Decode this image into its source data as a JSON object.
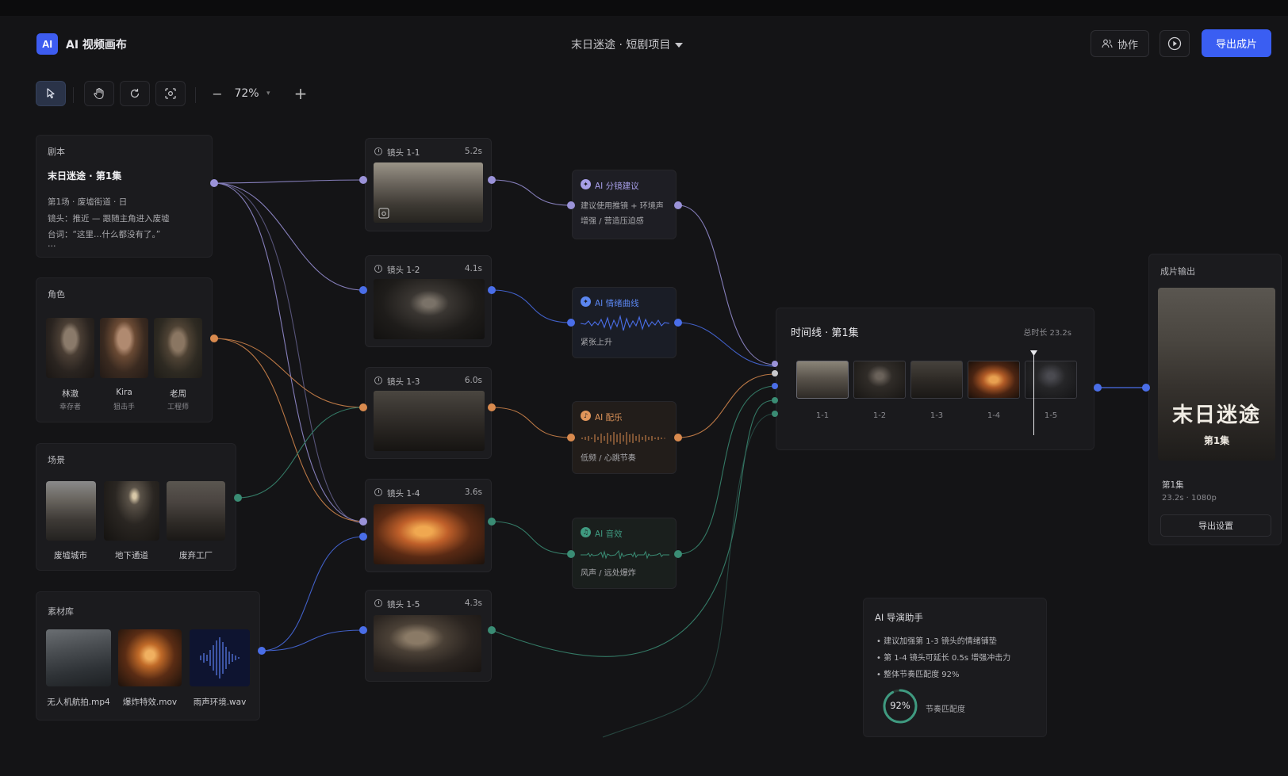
{
  "header": {
    "logo_text": "AI",
    "app_title": "AI 视频画布",
    "project_title": "末日迷途 · 短剧项目",
    "collab_label": "协作",
    "export_label": "导出成片"
  },
  "toolbar": {
    "zoom": "72%",
    "zoom_minus": "−",
    "zoom_plus": "+"
  },
  "script_panel": {
    "title": "剧本",
    "name": "末日迷途 · 第1集",
    "lines": [
      "第1场 · 废墟街道 · 日",
      "镜头：推近 — 跟随主角进入废墟",
      "台词：“这里…什么都没有了。”",
      "…"
    ]
  },
  "characters": {
    "title": "角色",
    "items": [
      {
        "name": "林澈",
        "role": "幸存者"
      },
      {
        "name": "Kira",
        "role": "狙击手"
      },
      {
        "name": "老周",
        "role": "工程师"
      }
    ]
  },
  "scenes": {
    "title": "场景",
    "items": [
      {
        "name": "废墟城市"
      },
      {
        "name": "地下通道"
      },
      {
        "name": "废弃工厂"
      }
    ]
  },
  "assets": {
    "title": "素材库",
    "items": [
      {
        "name": "无人机航拍.mp4"
      },
      {
        "name": "爆炸特效.mov"
      },
      {
        "name": "雨声环境.wav"
      }
    ]
  },
  "shots": [
    {
      "title": "镜头 1-1",
      "duration": "5.2s"
    },
    {
      "title": "镜头 1-2",
      "duration": "4.1s"
    },
    {
      "title": "镜头 1-3",
      "duration": "6.0s"
    },
    {
      "title": "镜头 1-4",
      "duration": "3.6s"
    },
    {
      "title": "镜头 1-5",
      "duration": "4.3s"
    }
  ],
  "ai_nodes": [
    {
      "title": "AI 分镜建议",
      "desc1": "建议使用推镜 + 环境声",
      "desc2": "增强 / 营造压迫感",
      "color": "#a79ee8"
    },
    {
      "title": "AI 情绪曲线",
      "desc1": "紧张上升",
      "color": "#5b86f0"
    },
    {
      "title": "AI 配乐",
      "desc1": "低频 / 心跳节奏",
      "color": "#e0955a"
    },
    {
      "title": "AI 音效",
      "desc1": "风声 / 远处爆炸",
      "color": "#3f9a80"
    }
  ],
  "timeline": {
    "title": "时间线 · 第1集",
    "total": "总时长 23.2s",
    "clips": [
      "1-1",
      "1-2",
      "1-3",
      "1-4",
      "1-5"
    ]
  },
  "output": {
    "title": "成片输出",
    "poster_title": "末日迷途",
    "poster_sub": "第1集",
    "episode": "第1集",
    "meta": "23.2s · 1080p",
    "settings_label": "导出设置"
  },
  "assistant": {
    "title": "AI 导演助手",
    "tips": [
      "建议加强第 1-3 镜头的情绪铺垫",
      "第 1-4 镜头可延长 0.5s 增强冲击力",
      "整体节奏匹配度 92%"
    ],
    "score": "92%",
    "score_value": 0.92,
    "score_label": "节奏匹配度"
  },
  "colors": {
    "accent": "#3a5ef2",
    "script_link": "#9a92d8",
    "character_link": "#d98a4e",
    "scene_link": "#3a8c74",
    "asset_link": "#4a6ee8"
  }
}
